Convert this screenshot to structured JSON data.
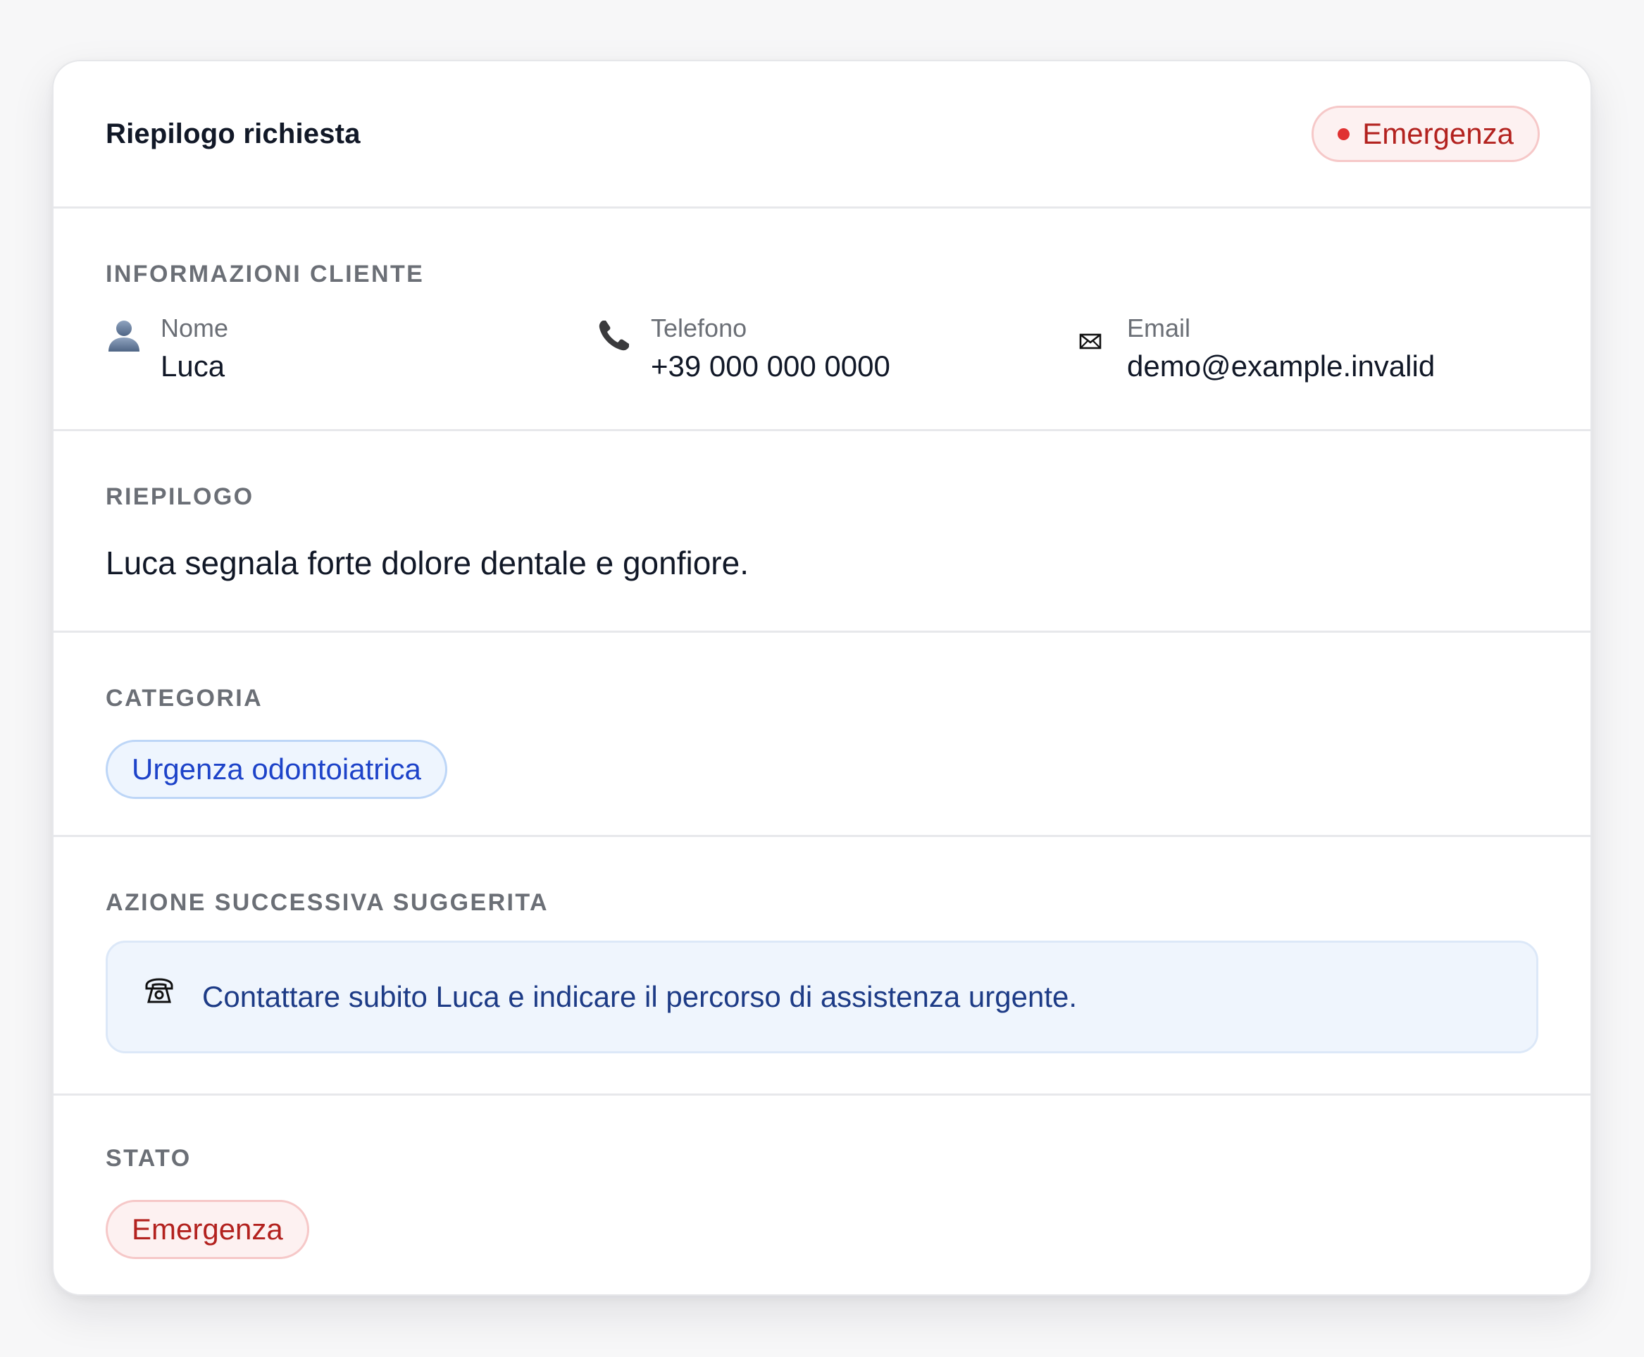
{
  "header": {
    "title": "Riepilogo richiesta",
    "badge": "Emergenza",
    "badge_color": "#e03131"
  },
  "client": {
    "section_label": "Informazioni cliente",
    "fields": [
      {
        "icon": "user-icon",
        "label": "Nome",
        "value": "Luca"
      },
      {
        "icon": "phone-icon",
        "label": "Telefono",
        "value": "+39 000 000 0000"
      },
      {
        "icon": "envelope-icon",
        "label": "Email",
        "value": "demo@example.invalid"
      }
    ]
  },
  "summary": {
    "section_label": "Riepilogo",
    "text": "Luca segnala forte dolore dentale e gonfiore."
  },
  "category": {
    "section_label": "Categoria",
    "value": "Urgenza odontoiatrica"
  },
  "action": {
    "section_label": "Azione successiva suggerita",
    "icon": "telephone-icon",
    "text": "Contattare subito Luca e indicare il percorso di assistenza urgente."
  },
  "status": {
    "section_label": "Stato",
    "value": "Emergenza"
  },
  "colors": {
    "emergency_text": "#b3221f",
    "category_text": "#1d43c9",
    "action_text": "#1d3b86"
  }
}
